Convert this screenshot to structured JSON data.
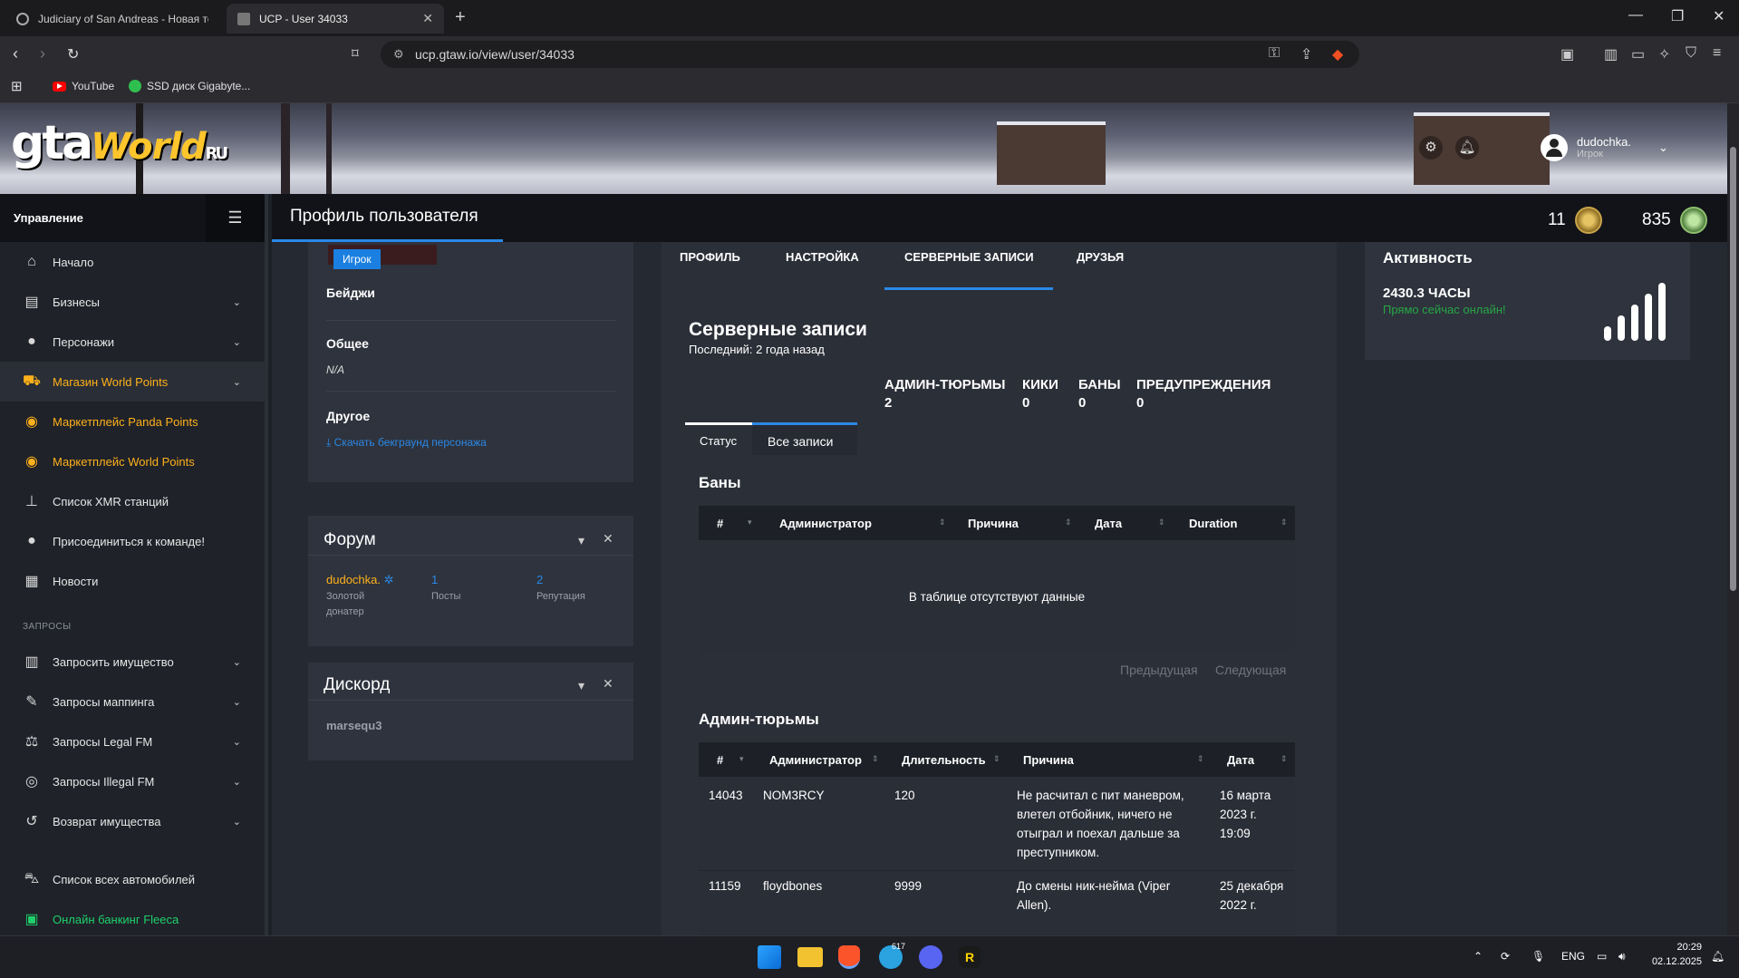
{
  "browser": {
    "tabs": [
      {
        "title": "Judiciary of San Andreas - Новая тем"
      },
      {
        "title": "UCP - User 34033"
      }
    ],
    "url": "ucp.gtaw.io/view/user/34033",
    "bookmarks": [
      "YouTube",
      "SSD диск Gigabyte..."
    ]
  },
  "header": {
    "logo_main": "gta",
    "logo_world": "World",
    "logo_ru": "RU",
    "username": "dudochka.",
    "user_role": "Игрок"
  },
  "sidebar": {
    "title": "Управление",
    "items": [
      {
        "label": "Начало",
        "icon": "home-icon"
      },
      {
        "label": "Бизнесы",
        "icon": "briefcase-icon"
      },
      {
        "label": "Персонажи",
        "icon": "person-icon"
      },
      {
        "label": "Магазин World Points",
        "icon": "cart-icon"
      },
      {
        "label": "Маркетплейс Panda Points",
        "icon": "coins-icon"
      },
      {
        "label": "Маркетплейс World Points",
        "icon": "coins-icon"
      },
      {
        "label": "Список XMR станций",
        "icon": "antenna-icon"
      },
      {
        "label": "Присоединиться к команде!",
        "icon": "person-icon"
      },
      {
        "label": "Новости",
        "icon": "news-icon"
      }
    ],
    "section_requests": "ЗАПРОСЫ",
    "requests": [
      {
        "label": "Запросить имущество",
        "icon": "building-icon"
      },
      {
        "label": "Запросы маппинга",
        "icon": "brush-icon"
      },
      {
        "label": "Запросы Legal FM",
        "icon": "scales-icon"
      },
      {
        "label": "Запросы Illegal FM",
        "icon": "mask-icon"
      },
      {
        "label": "Возврат имущества",
        "icon": "undo-icon"
      },
      {
        "label": "Список всех автомобилей",
        "icon": "car-icon"
      },
      {
        "label": "Онлайн банкинг Fleeca",
        "icon": "money-icon"
      }
    ]
  },
  "topbar": {
    "page_title": "Профиль пользователя",
    "stat1": "11",
    "stat2": "835"
  },
  "profile_card": {
    "role_badge": "Игрок",
    "badges_label": "Бейджи",
    "general_label": "Общее",
    "general_value": "N/A",
    "other_label": "Другое",
    "download_link": "Скачать бекграунд персонажа"
  },
  "forum_card": {
    "title": "Форум",
    "username": "dudochka.",
    "user_title_line1": "Золотой",
    "user_title_line2": "донатер",
    "posts_value": "1",
    "posts_label": "Посты",
    "rep_value": "2",
    "rep_label": "Репутация"
  },
  "discord_card": {
    "title": "Дискорд",
    "username": "marsequ3"
  },
  "main_tabs": [
    "ПРОФИЛЬ",
    "НАСТРОЙКА",
    "СЕРВЕРНЫЕ ЗАПИСИ",
    "ДРУЗЬЯ"
  ],
  "records": {
    "title": "Серверные записи",
    "last": "Последний: 2 года назад",
    "counters": [
      {
        "label": "АДМИН-ТЮРЬМЫ",
        "value": "2"
      },
      {
        "label": "КИКИ",
        "value": "0"
      },
      {
        "label": "БАНЫ",
        "value": "0"
      },
      {
        "label": "ПРЕДУПРЕЖДЕНИЯ",
        "value": "0"
      }
    ],
    "subtabs": [
      "Статус",
      "Все записи"
    ],
    "bans": {
      "title": "Баны",
      "columns": [
        "#",
        "Администратор",
        "Причина",
        "Дата",
        "Duration"
      ],
      "empty": "В таблице отсутствуют данные",
      "prev": "Предыдущая",
      "next": "Следующая"
    },
    "jails": {
      "title": "Админ-тюрьмы",
      "columns": [
        "#",
        "Администратор",
        "Длительность",
        "Причина",
        "Дата"
      ],
      "rows": [
        {
          "id": "14043",
          "admin": "NOM3RCY",
          "duration": "120",
          "reason": "Не расчитал с пит маневром, влетел отбойник, ничего не отыграл и поехал дальше за преступником.",
          "date": "16 марта 2023 г. 19:09"
        },
        {
          "id": "11159",
          "admin": "floydbones",
          "duration": "9999",
          "reason": "До смены ник-нейма (Viper Allen).",
          "date": "25 декабря 2022 г."
        }
      ]
    }
  },
  "activity": {
    "title": "Активность",
    "hours": "2430.3 ЧАСЫ",
    "status": "Прямо сейчас онлайн!"
  },
  "taskbar": {
    "lang": "ENG",
    "time": "20:29",
    "date": "02.12.2025",
    "telegram_badge": "617"
  }
}
